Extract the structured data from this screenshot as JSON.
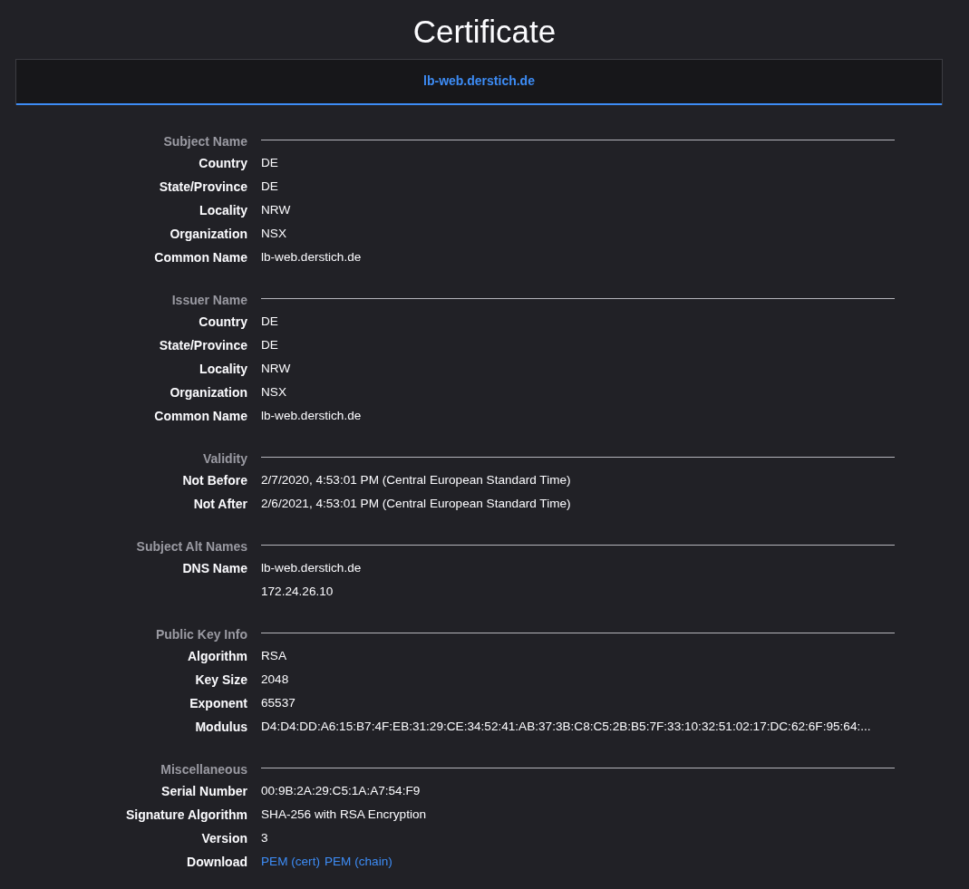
{
  "title": "Certificate",
  "tabs": [
    {
      "label": "lb-web.derstich.de",
      "selected": true
    }
  ],
  "sections": [
    {
      "title": "Subject Name",
      "rows": [
        {
          "label": "Country",
          "value": "DE"
        },
        {
          "label": "State/Province",
          "value": "DE"
        },
        {
          "label": "Locality",
          "value": "NRW"
        },
        {
          "label": "Organization",
          "value": "NSX"
        },
        {
          "label": "Common Name",
          "value": "lb-web.derstich.de"
        }
      ]
    },
    {
      "title": "Issuer Name",
      "rows": [
        {
          "label": "Country",
          "value": "DE"
        },
        {
          "label": "State/Province",
          "value": "DE"
        },
        {
          "label": "Locality",
          "value": "NRW"
        },
        {
          "label": "Organization",
          "value": "NSX"
        },
        {
          "label": "Common Name",
          "value": "lb-web.derstich.de"
        }
      ]
    },
    {
      "title": "Validity",
      "rows": [
        {
          "label": "Not Before",
          "value": "2/7/2020, 4:53:01 PM (Central European Standard Time)"
        },
        {
          "label": "Not After",
          "value": "2/6/2021, 4:53:01 PM (Central European Standard Time)"
        }
      ]
    },
    {
      "title": "Subject Alt Names",
      "rows": [
        {
          "label": "DNS Name",
          "value": "lb-web.derstich.de"
        },
        {
          "value": "172.24.26.10"
        }
      ]
    },
    {
      "title": "Public Key Info",
      "rows": [
        {
          "label": "Algorithm",
          "value": "RSA"
        },
        {
          "label": "Key Size",
          "value": "2048"
        },
        {
          "label": "Exponent",
          "value": "65537"
        },
        {
          "label": "Modulus",
          "value": "D4:D4:DD:A6:15:B7:4F:EB:31:29:CE:34:52:41:AB:37:3B:C8:C5:2B:B5:7F:33:10:32:51:02:17:DC:62:6F:95:64:..."
        }
      ]
    },
    {
      "title": "Miscellaneous",
      "rows": [
        {
          "label": "Serial Number",
          "value": "00:9B:2A:29:C5:1A:A7:54:F9"
        },
        {
          "label": "Signature Algorithm",
          "value": "SHA-256 with RSA Encryption"
        },
        {
          "label": "Version",
          "value": "3"
        },
        {
          "label": "Download",
          "links": [
            "PEM (cert)",
            "PEM (chain)"
          ]
        }
      ]
    }
  ]
}
